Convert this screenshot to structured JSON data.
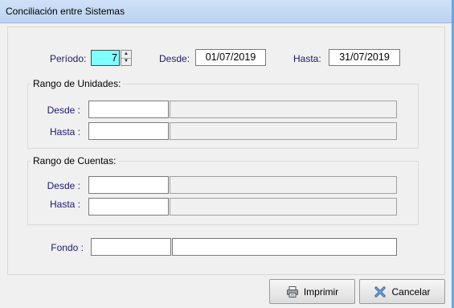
{
  "window": {
    "title": "Conciliación entre Sistemas"
  },
  "periodo": {
    "label": "Período:",
    "value": "7"
  },
  "desde": {
    "label": "Desde:",
    "value": "01/07/2019"
  },
  "hasta": {
    "label": "Hasta:",
    "value": "31/07/2019"
  },
  "unidades": {
    "title": "Rango de Unidades:",
    "desde_label": "Desde :",
    "hasta_label": "Hasta :",
    "desde_code": "",
    "desde_desc": "",
    "hasta_code": "",
    "hasta_desc": ""
  },
  "cuentas": {
    "title": "Rango de Cuentas:",
    "desde_label": "Desde :",
    "hasta_label": "Hasta :",
    "desde_code": "",
    "desde_desc": "",
    "hasta_code": "",
    "hasta_desc": ""
  },
  "fondo": {
    "label": "Fondo :",
    "code": "",
    "desc": ""
  },
  "buttons": {
    "print": "Imprimir",
    "cancel": "Cancelar"
  }
}
